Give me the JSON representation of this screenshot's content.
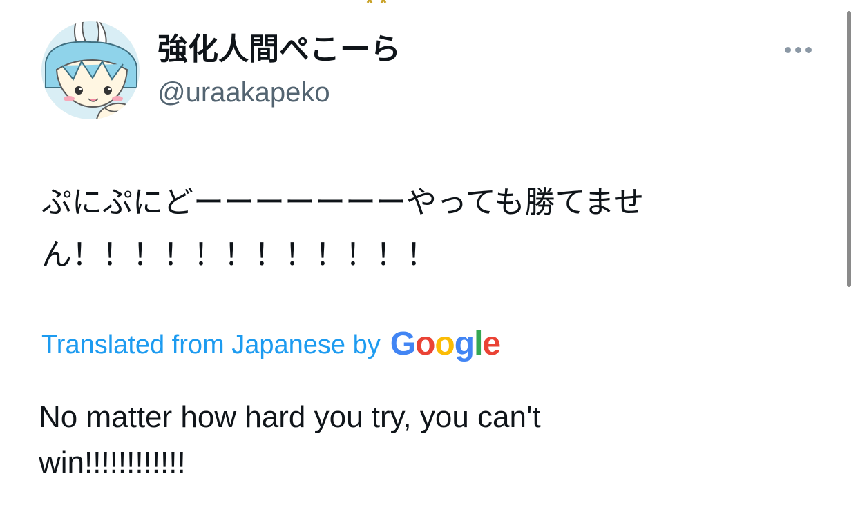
{
  "tweet": {
    "author": {
      "display_name": "強化人間ぺこーら",
      "handle": "@uraakapeko",
      "avatar_icon": "avatar-rabbit-girl-icon"
    },
    "more_icon": "more-horizontal-icon",
    "text": "ぷにぷにどーーーーーーーやっても勝てません！！！！！！！！！！！！",
    "translation": {
      "label": "Translated from Japanese by",
      "provider": {
        "letters": [
          "G",
          "o",
          "o",
          "g",
          "l",
          "e"
        ],
        "colors": [
          "#4285f4",
          "#ea4335",
          "#fbbc05",
          "#4285f4",
          "#34a853",
          "#ea4335"
        ]
      },
      "text": "No matter how hard you try, you can't win!!!!!!!!!!!!"
    }
  },
  "colors": {
    "text_primary": "#0f1419",
    "text_secondary": "#536471",
    "link": "#1d9bf0"
  }
}
